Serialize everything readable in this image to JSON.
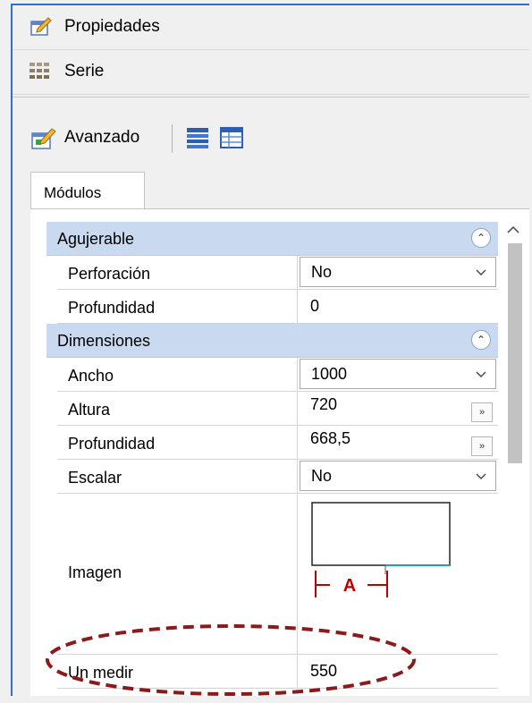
{
  "menu": {
    "propiedades": "Propiedades",
    "serie": "Serie"
  },
  "toolbar": {
    "avanzado": "Avanzado"
  },
  "tabs": {
    "active": "Módulos"
  },
  "categories": {
    "agujerable": {
      "title": "Agujerable",
      "properties": {
        "perforacion": {
          "name": "Perforación",
          "value": "No"
        },
        "profundidad": {
          "name": "Profundidad",
          "value": "0"
        }
      }
    },
    "dimensiones": {
      "title": "Dimensiones",
      "properties": {
        "ancho": {
          "name": "Ancho",
          "value": "1000"
        },
        "altura": {
          "name": "Altura",
          "value": "720"
        },
        "profundidad": {
          "name": "Profundidad",
          "value": "668,5"
        },
        "escalar": {
          "name": "Escalar",
          "value": "No"
        },
        "imagen": {
          "name": "Imagen",
          "diagram_label": "A"
        },
        "un_medir": {
          "name": "Un medir",
          "value": "550"
        }
      }
    }
  },
  "icons": {
    "ellipsis_glyph": "»",
    "collapse_glyph": "⌃"
  },
  "colors": {
    "window_border": "#2e6fd0",
    "category_bg": "#c9daf0",
    "annotation": "#8b1a1a",
    "diagram_accent": "#c00000",
    "diagram_teal": "#1aa0b8"
  }
}
